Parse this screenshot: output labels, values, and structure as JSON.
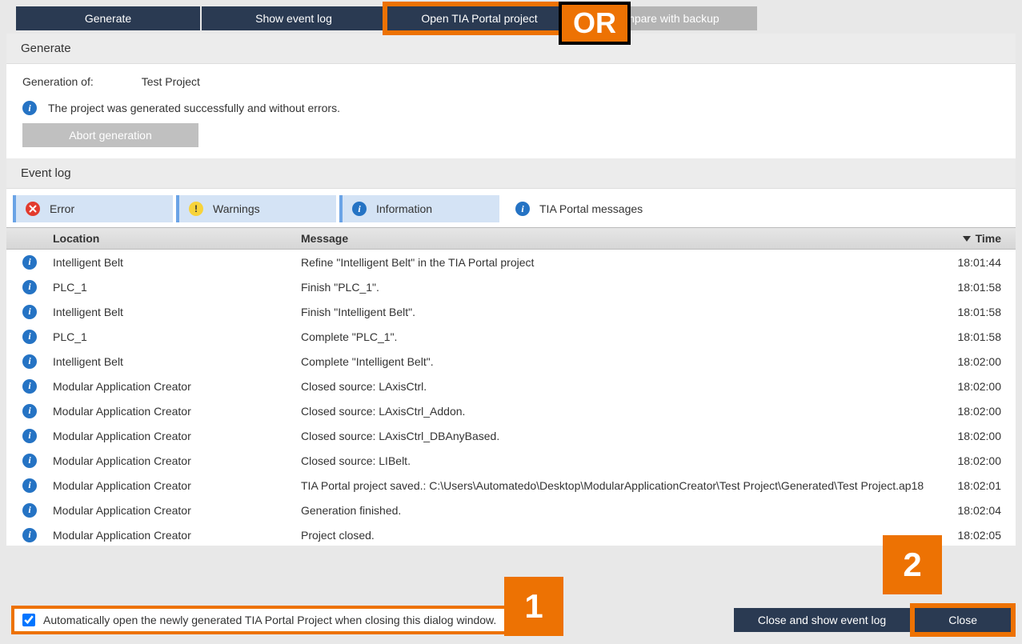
{
  "topbar": {
    "generate": "Generate",
    "show_event_log": "Show event log",
    "open_tia": "Open TIA Portal project",
    "compare": "Compare with backup"
  },
  "annotations": {
    "or": "OR",
    "one": "1",
    "two": "2"
  },
  "section_generate": "Generate",
  "generation": {
    "of_label": "Generation of:",
    "project_name": "Test Project",
    "status_msg": "The project was generated successfully and without errors.",
    "abort_label": "Abort generation"
  },
  "section_eventlog": "Event log",
  "filters": {
    "error": "Error",
    "warnings": "Warnings",
    "information": "Information",
    "tia_messages": "TIA Portal messages"
  },
  "columns": {
    "location": "Location",
    "message": "Message",
    "time": "Time"
  },
  "log": [
    {
      "loc": "Intelligent Belt",
      "msg": "Refine \"Intelligent Belt\" in the TIA Portal project",
      "time": "18:01:44"
    },
    {
      "loc": "PLC_1",
      "msg": "Finish \"PLC_1\".",
      "time": "18:01:58"
    },
    {
      "loc": "Intelligent Belt",
      "msg": "Finish \"Intelligent Belt\".",
      "time": "18:01:58"
    },
    {
      "loc": "PLC_1",
      "msg": "Complete \"PLC_1\".",
      "time": "18:01:58"
    },
    {
      "loc": "Intelligent Belt",
      "msg": "Complete \"Intelligent Belt\".",
      "time": "18:02:00"
    },
    {
      "loc": "Modular Application Creator",
      "msg": "Closed source: LAxisCtrl.",
      "time": "18:02:00"
    },
    {
      "loc": "Modular Application Creator",
      "msg": "Closed source: LAxisCtrl_Addon.",
      "time": "18:02:00"
    },
    {
      "loc": "Modular Application Creator",
      "msg": "Closed source: LAxisCtrl_DBAnyBased.",
      "time": "18:02:00"
    },
    {
      "loc": "Modular Application Creator",
      "msg": "Closed source: LIBelt.",
      "time": "18:02:00"
    },
    {
      "loc": "Modular Application Creator",
      "msg": "TIA Portal project saved.: C:\\Users\\Automatedo\\Desktop\\ModularApplicationCreator\\Test Project\\Generated\\Test Project.ap18",
      "time": "18:02:01"
    },
    {
      "loc": "Modular Application Creator",
      "msg": "Generation finished.",
      "time": "18:02:04"
    },
    {
      "loc": "Modular Application Creator",
      "msg": "Project closed.",
      "time": "18:02:05"
    }
  ],
  "footer": {
    "auto_open_label": "Automatically open the newly generated TIA Portal Project when closing this dialog window.",
    "close_and_show": "Close and show event log",
    "close": "Close"
  }
}
